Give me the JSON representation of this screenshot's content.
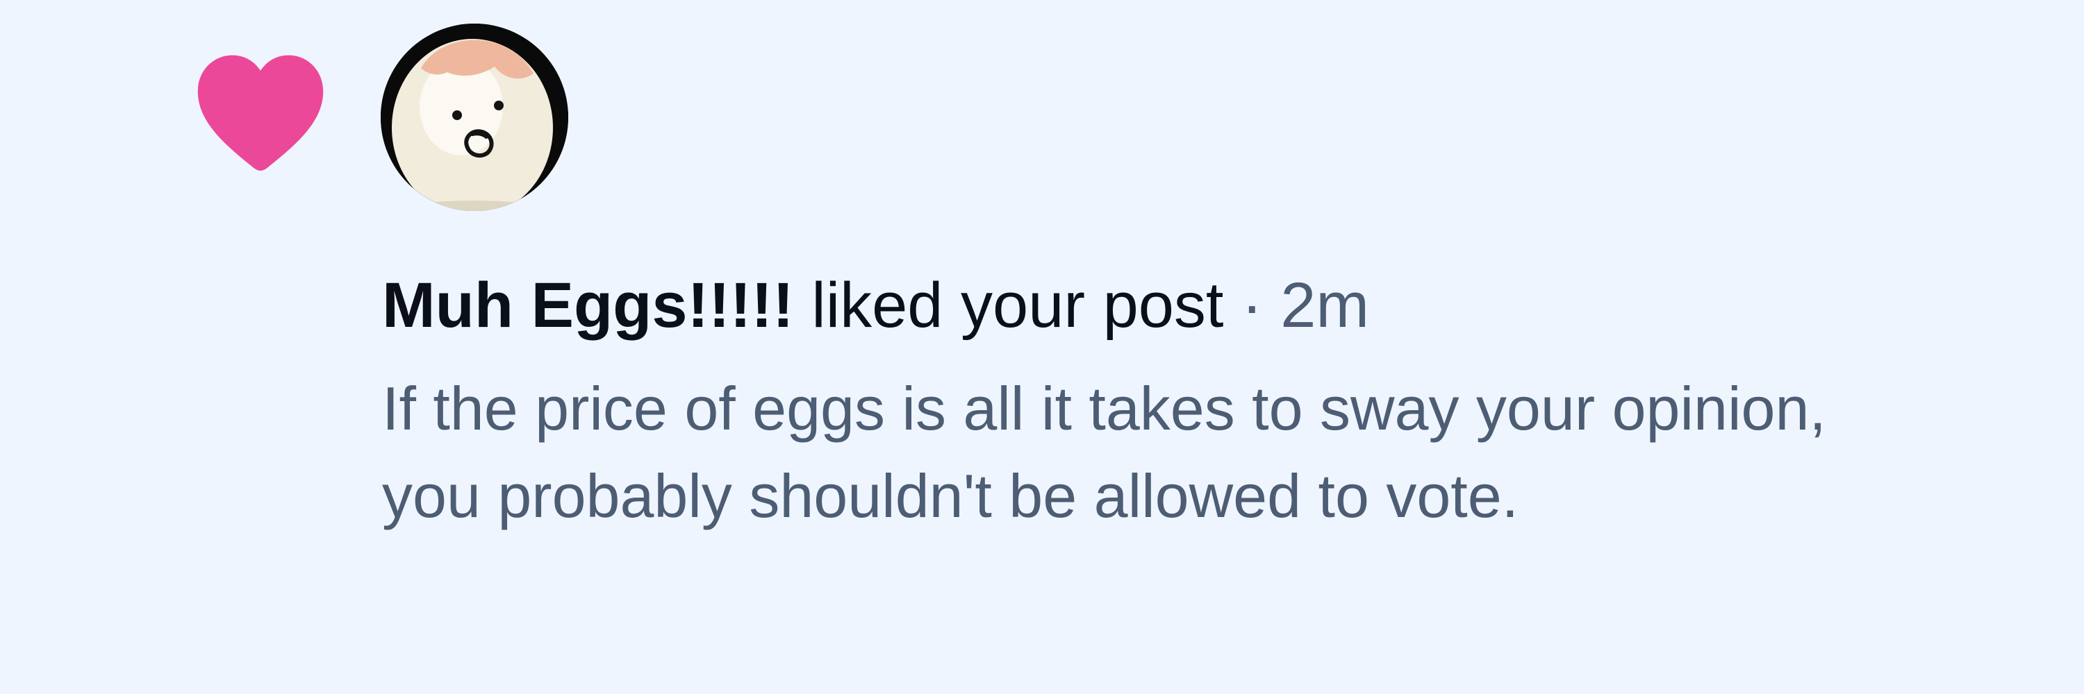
{
  "notification": {
    "type_icon": "heart-icon",
    "avatar_icon": "egg-face-avatar",
    "colors": {
      "background": "#eff5fe",
      "heart": "#ec4899",
      "name_text": "#0b0f19",
      "muted_text": "#4c5d74"
    },
    "username": "Muh Eggs!!!!!",
    "action": "liked your post",
    "separator": "·",
    "time_ago": "2m",
    "post_text": "If the price of eggs is all it takes to sway your opinion, you probably shouldn't be allowed to vote."
  }
}
